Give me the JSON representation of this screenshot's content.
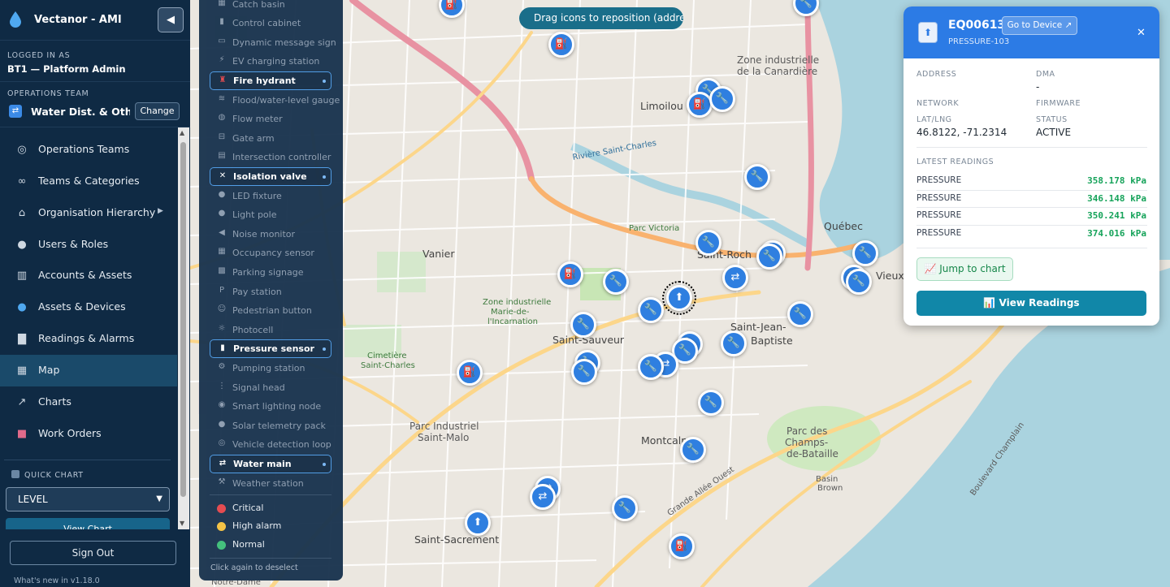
{
  "sidebar": {
    "app_title": "Vectanor - AMI",
    "collapse_icon": "chevron-left-icon",
    "logged_in_caption": "LOGGED IN AS",
    "logged_in_user": "BT1 — Platform Admin",
    "operations_caption": "OPERATIONS TEAM",
    "team_name": "Water Dist. & Othe...",
    "change_label": "Change",
    "items": [
      {
        "label": "Operations Teams",
        "icon": "compass-icon"
      },
      {
        "label": "Teams & Categories",
        "icon": "link-icon"
      },
      {
        "label": "Organisation Hierarchy",
        "icon": "building-icon"
      },
      {
        "label": "Users & Roles",
        "icon": "user-icon"
      },
      {
        "label": "Accounts & Assets",
        "icon": "office-icon"
      },
      {
        "label": "Assets & Devices",
        "icon": "droplet-icon"
      },
      {
        "label": "Readings & Alarms",
        "icon": "bar-chart-icon"
      },
      {
        "label": "Map",
        "icon": "map-icon"
      },
      {
        "label": "Charts",
        "icon": "line-chart-icon"
      },
      {
        "label": "Work Orders",
        "icon": "toolbox-icon"
      }
    ],
    "quick_chart_caption": "QUICK CHART",
    "quick_chart_selected": "LEVEL",
    "view_chart_label": "View Chart",
    "sign_out_label": "Sign Out",
    "whats_new": "What's new in v1.18.0"
  },
  "map": {
    "hint": "Drag icons to reposition (address auto-updates)",
    "labels": [
      {
        "text": "Limoilou"
      },
      {
        "text": "Zone industrielle"
      },
      {
        "text": "de la Canardière"
      },
      {
        "text": "Vanier"
      },
      {
        "text": "Saint-Roch"
      },
      {
        "text": "Saint-Sauveur"
      },
      {
        "text": "Saint-Jean-"
      },
      {
        "text": "Baptiste"
      },
      {
        "text": "Montcalm"
      },
      {
        "text": "Parc Industriel"
      },
      {
        "text": "Saint-Malo"
      },
      {
        "text": "Saint-Sacrement"
      },
      {
        "text": "Parc des"
      },
      {
        "text": "Champs-"
      },
      {
        "text": "de-Bataille"
      },
      {
        "text": "Québec"
      },
      {
        "text": "Vieux"
      },
      {
        "text": "Parc Victoria"
      },
      {
        "text": "Zone industrielle"
      },
      {
        "text": "Marie-de-"
      },
      {
        "text": "l'Incarnation"
      },
      {
        "text": "Cimetière"
      },
      {
        "text": "Saint-Charles"
      },
      {
        "text": "Boulevard Champlain"
      },
      {
        "text": "Grande Allée Ouest"
      },
      {
        "text": "Rivière Saint-Charles"
      },
      {
        "text": "Basin"
      },
      {
        "text": "Brown"
      },
      {
        "text": "Notre-Dame"
      }
    ]
  },
  "layers": {
    "items": [
      {
        "label": "Catch basin",
        "icon": "catch-basin-icon",
        "on": false
      },
      {
        "label": "Control cabinet",
        "icon": "cabinet-icon",
        "on": false
      },
      {
        "label": "Dynamic message sign",
        "icon": "sign-icon",
        "on": false
      },
      {
        "label": "EV charging station",
        "icon": "ev-icon",
        "on": false
      },
      {
        "label": "Fire hydrant",
        "icon": "hydrant-icon",
        "on": true
      },
      {
        "label": "Flood/water-level gauge",
        "icon": "gauge-icon",
        "on": false
      },
      {
        "label": "Flow meter",
        "icon": "flow-icon",
        "on": false
      },
      {
        "label": "Gate arm",
        "icon": "gate-icon",
        "on": false
      },
      {
        "label": "Intersection controller",
        "icon": "controller-icon",
        "on": false
      },
      {
        "label": "Isolation valve",
        "icon": "wrench-icon",
        "on": true
      },
      {
        "label": "LED fixture",
        "icon": "bulb-icon",
        "on": false
      },
      {
        "label": "Light pole",
        "icon": "pole-icon",
        "on": false
      },
      {
        "label": "Noise monitor",
        "icon": "speaker-icon",
        "on": false
      },
      {
        "label": "Occupancy sensor",
        "icon": "grid-icon",
        "on": false
      },
      {
        "label": "Parking signage",
        "icon": "parking-icon",
        "on": false
      },
      {
        "label": "Pay station",
        "icon": "pay-icon",
        "on": false
      },
      {
        "label": "Pedestrian button",
        "icon": "pedestrian-icon",
        "on": false
      },
      {
        "label": "Photocell",
        "icon": "sun-icon",
        "on": false
      },
      {
        "label": "Pressure sensor",
        "icon": "pressure-icon",
        "on": true
      },
      {
        "label": "Pumping station",
        "icon": "gear-icon",
        "on": false
      },
      {
        "label": "Signal head",
        "icon": "signal-icon",
        "on": false
      },
      {
        "label": "Smart lighting node",
        "icon": "node-icon",
        "on": false
      },
      {
        "label": "Solar telemetry pack",
        "icon": "solar-icon",
        "on": false
      },
      {
        "label": "Vehicle detection loop",
        "icon": "loop-icon",
        "on": false
      },
      {
        "label": "Water main",
        "icon": "pipe-icon",
        "on": true
      },
      {
        "label": "Weather station",
        "icon": "weather-icon",
        "on": false
      }
    ],
    "legend": [
      {
        "label": "Critical",
        "color": "#e5484d"
      },
      {
        "label": "High alarm",
        "color": "#f5c242"
      },
      {
        "label": "Normal",
        "color": "#3fbf7a"
      }
    ],
    "footer": "Click again to deselect"
  },
  "device_card": {
    "id": "EQ00613",
    "goto_label": "Go to Device ↗",
    "subtitle": "PRESSURE-103",
    "fields": {
      "address_caption": "ADDRESS",
      "address_value": "",
      "dma_caption": "DMA",
      "dma_value": "-",
      "network_caption": "NETWORK",
      "firmware_caption": "FIRMWARE",
      "latlng_caption": "LAT/LNG",
      "latlng_value": "46.8122, -71.2314",
      "status_caption": "STATUS",
      "status_value": "ACTIVE"
    },
    "latest_caption": "LATEST READINGS",
    "readings": [
      {
        "label": "PRESSURE",
        "value": "358.178 kPa"
      },
      {
        "label": "PRESSURE",
        "value": "346.148 kPa"
      },
      {
        "label": "PRESSURE",
        "value": "350.241 kPa"
      },
      {
        "label": "PRESSURE",
        "value": "374.016 kPa"
      }
    ],
    "jump_label": "📈 Jump to chart",
    "view_readings_label": "📊 View Readings",
    "accent": "#2c7be5",
    "reading_color": "#16a35a"
  }
}
